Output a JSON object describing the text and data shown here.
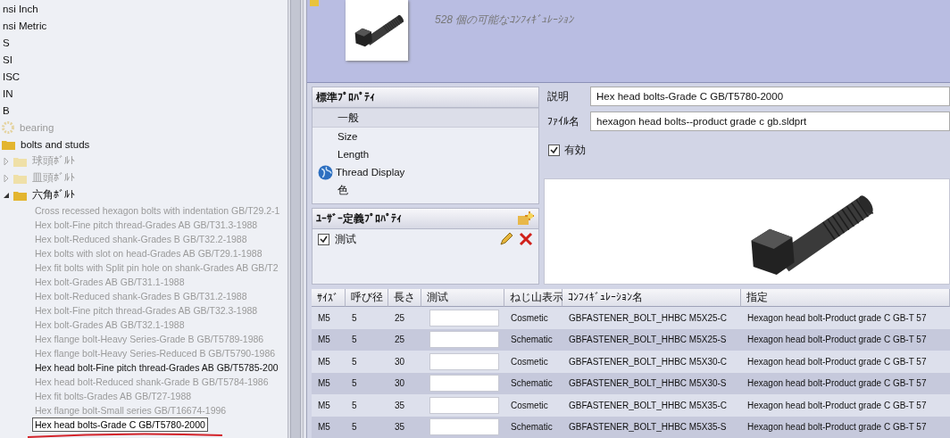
{
  "tree": [
    {
      "label": "nsi Inch",
      "disabled": false,
      "selected": false
    },
    {
      "label": "nsi Metric",
      "disabled": false,
      "selected": false
    },
    {
      "label": "S",
      "disabled": false,
      "selected": false
    },
    {
      "label": "SI",
      "disabled": false,
      "selected": false
    },
    {
      "label": "ISC",
      "disabled": false,
      "selected": false
    },
    {
      "label": "IN",
      "disabled": false,
      "selected": false
    },
    {
      "label": "B",
      "disabled": false,
      "selected": false,
      "children": [
        {
          "label": "bearing",
          "kind": "gear",
          "disabled": true,
          "selected": false
        },
        {
          "label": "bolts and studs",
          "kind": "folder",
          "disabled": false,
          "selected": false,
          "children": [
            {
              "label": "球頭ﾎﾞﾙﾄ",
              "kind": "folder",
              "disabled": true,
              "selected": false,
              "expanded": false
            },
            {
              "label": "皿頭ﾎﾞﾙﾄ",
              "kind": "folder",
              "disabled": true,
              "selected": false,
              "expanded": false
            },
            {
              "label": "六角ﾎﾞﾙﾄ",
              "kind": "folder",
              "disabled": false,
              "selected": false,
              "expanded": true,
              "children": [
                {
                  "label": "Cross recessed hexagon bolts with indentation GB/T29.2-1",
                  "disabled": true,
                  "selected": false
                },
                {
                  "label": "Hex bolt-Fine pitch thread-Grades AB GB/T31.3-1988",
                  "disabled": true,
                  "selected": false
                },
                {
                  "label": "Hex bolt-Reduced shank-Grades B GB/T32.2-1988",
                  "disabled": true,
                  "selected": false
                },
                {
                  "label": "Hex bolts with slot on head-Grades AB GB/T29.1-1988",
                  "disabled": true,
                  "selected": false
                },
                {
                  "label": "Hex fit bolts with Split pin hole on shank-Grades AB GB/T2",
                  "disabled": true,
                  "selected": false
                },
                {
                  "label": "Hex bolt-Grades AB GB/T31.1-1988",
                  "disabled": true,
                  "selected": false
                },
                {
                  "label": "Hex bolt-Reduced shank-Grades B GB/T31.2-1988",
                  "disabled": true,
                  "selected": false
                },
                {
                  "label": "Hex bolt-Fine pitch thread-Grades AB GB/T32.3-1988",
                  "disabled": true,
                  "selected": false
                },
                {
                  "label": "Hex bolt-Grades AB GB/T32.1-1988",
                  "disabled": true,
                  "selected": false
                },
                {
                  "label": "Hex flange bolt-Heavy Series-Grade B GB/T5789-1986",
                  "disabled": true,
                  "selected": false
                },
                {
                  "label": "Hex flange bolt-Heavy Series-Reduced B GB/T5790-1986",
                  "disabled": true,
                  "selected": false
                },
                {
                  "label": "Hex head bolt-Fine pitch thread-Grades AB GB/T5785-200",
                  "disabled": false,
                  "selected": false
                },
                {
                  "label": "Hex head bolt-Reduced shank-Grade B GB/T5784-1986",
                  "disabled": true,
                  "selected": false
                },
                {
                  "label": "Hex fit bolts-Grades AB GB/T27-1988",
                  "disabled": true,
                  "selected": false
                },
                {
                  "label": "Hex flange bolt-Small series GB/T16674-1996",
                  "disabled": true,
                  "selected": false
                },
                {
                  "label": "Hex head bolts-Grade C GB/T5780-2000",
                  "disabled": false,
                  "selected": true
                }
              ]
            }
          ]
        }
      ]
    }
  ],
  "header": {
    "configurations": "528 個の可能なｺﾝﾌｨｷﾞｭﾚｰｼｮﾝ"
  },
  "standard_properties": {
    "title": "標準ﾌﾟﾛﾊﾟﾃｨ",
    "items": [
      {
        "label": "一般",
        "kind": "plain",
        "selected": true
      },
      {
        "label": "Size",
        "kind": "plain",
        "selected": false
      },
      {
        "label": "Length",
        "kind": "plain",
        "selected": false
      },
      {
        "label": "Thread Display",
        "kind": "globe",
        "selected": false
      },
      {
        "label": "色",
        "kind": "plain",
        "selected": false
      }
    ]
  },
  "custom_properties": {
    "title": "ﾕｰｻﾞｰ定義ﾌﾟﾛﾊﾟﾃｨ",
    "items": [
      {
        "label": "測试",
        "checked": true
      }
    ]
  },
  "fields": [
    {
      "label": "説明",
      "value": "Hex head bolts-Grade C GB/T5780-2000"
    },
    {
      "label": "ﾌｧｲﾙ名",
      "value": "hexagon head bolts--product grade c gb.sldprt"
    }
  ],
  "enabled": {
    "label": "有効",
    "checked": true
  },
  "table": {
    "columns": [
      {
        "label": "ｻｲｽﾞ",
        "kind": "text"
      },
      {
        "label": "呼び径",
        "kind": "text"
      },
      {
        "label": "長さ",
        "kind": "text"
      },
      {
        "label": "測试",
        "kind": "input"
      },
      {
        "label": "ねじ山表示",
        "kind": "text"
      },
      {
        "label": "ｺﾝﾌｨｷﾞｭﾚｰｼｮﾝ名",
        "kind": "text"
      },
      {
        "label": "指定",
        "kind": "text"
      }
    ],
    "rows": [
      [
        "M5",
        "5",
        "25",
        "",
        "Cosmetic",
        "GBFASTENER_BOLT_HHBC M5X25-C",
        "Hexagon head bolt-Product grade C GB-T 57"
      ],
      [
        "M5",
        "5",
        "25",
        "",
        "Schematic",
        "GBFASTENER_BOLT_HHBC M5X25-S",
        "Hexagon head bolt-Product grade C GB-T 57"
      ],
      [
        "M5",
        "5",
        "30",
        "",
        "Cosmetic",
        "GBFASTENER_BOLT_HHBC M5X30-C",
        "Hexagon head bolt-Product grade C GB-T 57"
      ],
      [
        "M5",
        "5",
        "30",
        "",
        "Schematic",
        "GBFASTENER_BOLT_HHBC M5X30-S",
        "Hexagon head bolt-Product grade C GB-T 57"
      ],
      [
        "M5",
        "5",
        "35",
        "",
        "Cosmetic",
        "GBFASTENER_BOLT_HHBC M5X35-C",
        "Hexagon head bolt-Product grade C GB-T 57"
      ],
      [
        "M5",
        "5",
        "35",
        "",
        "Schematic",
        "GBFASTENER_BOLT_HHBC M5X35-S",
        "Hexagon head bolt-Product grade C GB-T 57"
      ]
    ]
  }
}
